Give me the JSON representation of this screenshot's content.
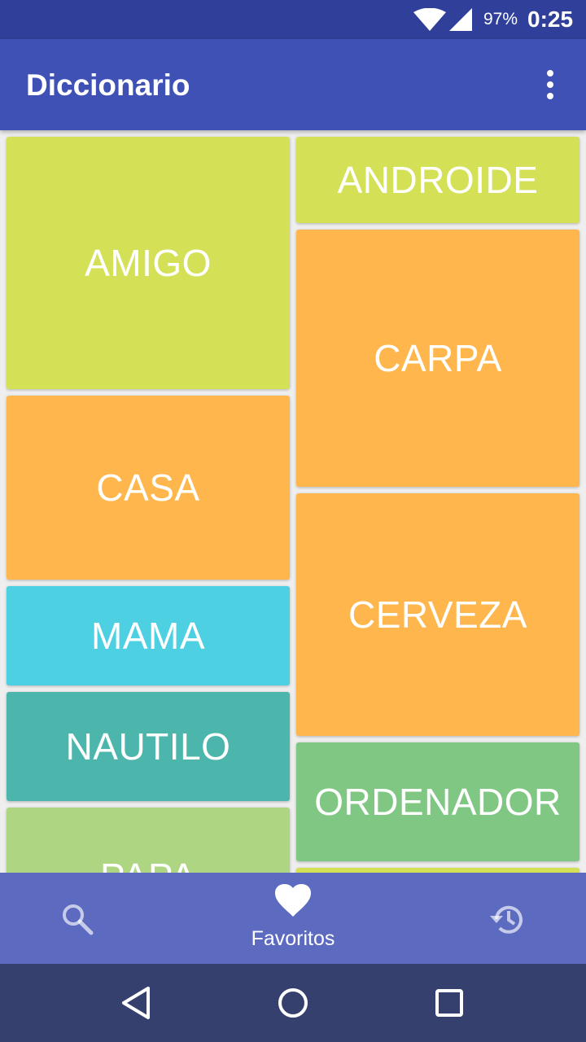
{
  "status_bar": {
    "battery": "97%",
    "time": "0:25",
    "icons": [
      "wifi-icon",
      "cell-signal-icon"
    ]
  },
  "app_bar": {
    "title": "Diccionario",
    "menu_icon": "more-vert-icon"
  },
  "words": [
    {
      "label": "AMIGO",
      "color": "#d4e157"
    },
    {
      "label": "ANDROIDE",
      "color": "#d4e157"
    },
    {
      "label": "CARPA",
      "color": "#ffb74d"
    },
    {
      "label": "CASA",
      "color": "#ffb74d"
    },
    {
      "label": "CERVEZA",
      "color": "#ffb74d"
    },
    {
      "label": "MAMA",
      "color": "#4dd0e1"
    },
    {
      "label": "NAUTILO",
      "color": "#4db6ac"
    },
    {
      "label": "ORDENADOR",
      "color": "#81c784"
    },
    {
      "label": "PAPA",
      "color": "#aed581"
    }
  ],
  "bottom_nav": {
    "search_icon": "search-icon",
    "favorites_icon": "heart-icon",
    "favorites_label": "Favoritos",
    "history_icon": "history-icon",
    "active": "Favoritos"
  },
  "system_nav": {
    "icons": [
      "back-icon",
      "home-icon",
      "recents-icon"
    ]
  },
  "colors": {
    "primary": "#3f51b5",
    "primary_dark": "#30409a",
    "bottom_nav": "#5c6bc0",
    "system_nav": "#35406f"
  }
}
